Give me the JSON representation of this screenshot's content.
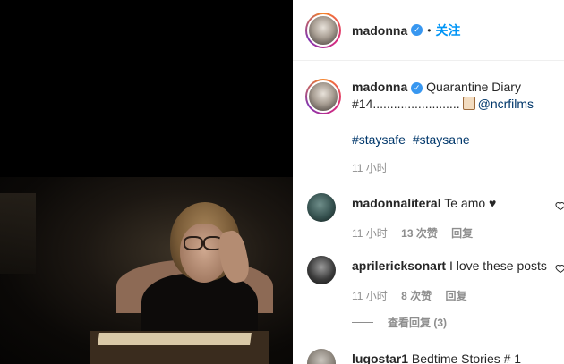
{
  "post": {
    "author": "madonna",
    "follow_label": "关注",
    "dot": "•",
    "caption_author": "madonna",
    "caption_text_1": "Quarantine Diary #14.........................",
    "caption_mention": "@ncrfilms",
    "hashtags": [
      "#staysafe",
      "#staysane"
    ],
    "time": "11 小时"
  },
  "comments": [
    {
      "username": "madonnaliteral",
      "text": "Te amo ♥",
      "time": "11 小时",
      "likes": "13 次赞",
      "reply_label": "回复"
    },
    {
      "username": "aprilericksonart",
      "text": "I love these posts",
      "time": "11 小时",
      "likes": "8 次赞",
      "reply_label": "回复"
    },
    {
      "username": "lugostar1",
      "text": "Bedtime Stories # 1"
    }
  ],
  "view_replies": "查看回复 (3)",
  "icons": {
    "verified": "verified-badge-icon",
    "heart": "heart-outline-icon",
    "emoji": "scroll-emoji-icon"
  },
  "colors": {
    "link": "#00376b",
    "follow": "#0095f6",
    "verified": "#3897f0",
    "meta": "#8e8e8e"
  }
}
